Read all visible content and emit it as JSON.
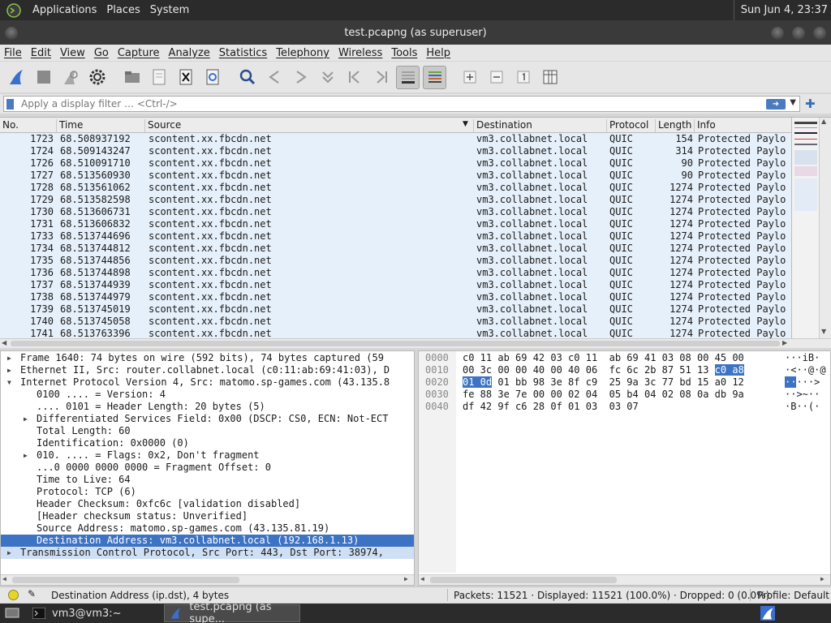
{
  "top_panel": {
    "menus": [
      "Applications",
      "Places",
      "System"
    ],
    "clock": "Sun Jun  4, 23:37"
  },
  "window": {
    "title": "test.pcapng (as superuser)"
  },
  "menubar": [
    "File",
    "Edit",
    "View",
    "Go",
    "Capture",
    "Analyze",
    "Statistics",
    "Telephony",
    "Wireless",
    "Tools",
    "Help"
  ],
  "filter": {
    "placeholder": "Apply a display filter … <Ctrl-/>"
  },
  "packet_list": {
    "columns": [
      "No.",
      "Time",
      "Source",
      "Destination",
      "Protocol",
      "Length",
      "Info"
    ],
    "rows": [
      [
        "1723",
        "68.508937192",
        "scontent.xx.fbcdn.net",
        "vm3.collabnet.local",
        "QUIC",
        "154",
        "Protected Paylo"
      ],
      [
        "1724",
        "68.509143247",
        "scontent.xx.fbcdn.net",
        "vm3.collabnet.local",
        "QUIC",
        "314",
        "Protected Paylo"
      ],
      [
        "1726",
        "68.510091710",
        "scontent.xx.fbcdn.net",
        "vm3.collabnet.local",
        "QUIC",
        "90",
        "Protected Paylo"
      ],
      [
        "1727",
        "68.513560930",
        "scontent.xx.fbcdn.net",
        "vm3.collabnet.local",
        "QUIC",
        "90",
        "Protected Paylo"
      ],
      [
        "1728",
        "68.513561062",
        "scontent.xx.fbcdn.net",
        "vm3.collabnet.local",
        "QUIC",
        "1274",
        "Protected Paylo"
      ],
      [
        "1729",
        "68.513582598",
        "scontent.xx.fbcdn.net",
        "vm3.collabnet.local",
        "QUIC",
        "1274",
        "Protected Paylo"
      ],
      [
        "1730",
        "68.513606731",
        "scontent.xx.fbcdn.net",
        "vm3.collabnet.local",
        "QUIC",
        "1274",
        "Protected Paylo"
      ],
      [
        "1731",
        "68.513606832",
        "scontent.xx.fbcdn.net",
        "vm3.collabnet.local",
        "QUIC",
        "1274",
        "Protected Paylo"
      ],
      [
        "1733",
        "68.513744696",
        "scontent.xx.fbcdn.net",
        "vm3.collabnet.local",
        "QUIC",
        "1274",
        "Protected Paylo"
      ],
      [
        "1734",
        "68.513744812",
        "scontent.xx.fbcdn.net",
        "vm3.collabnet.local",
        "QUIC",
        "1274",
        "Protected Paylo"
      ],
      [
        "1735",
        "68.513744856",
        "scontent.xx.fbcdn.net",
        "vm3.collabnet.local",
        "QUIC",
        "1274",
        "Protected Paylo"
      ],
      [
        "1736",
        "68.513744898",
        "scontent.xx.fbcdn.net",
        "vm3.collabnet.local",
        "QUIC",
        "1274",
        "Protected Paylo"
      ],
      [
        "1737",
        "68.513744939",
        "scontent.xx.fbcdn.net",
        "vm3.collabnet.local",
        "QUIC",
        "1274",
        "Protected Paylo"
      ],
      [
        "1738",
        "68.513744979",
        "scontent.xx.fbcdn.net",
        "vm3.collabnet.local",
        "QUIC",
        "1274",
        "Protected Paylo"
      ],
      [
        "1739",
        "68.513745019",
        "scontent.xx.fbcdn.net",
        "vm3.collabnet.local",
        "QUIC",
        "1274",
        "Protected Paylo"
      ],
      [
        "1740",
        "68.513745058",
        "scontent.xx.fbcdn.net",
        "vm3.collabnet.local",
        "QUIC",
        "1274",
        "Protected Paylo"
      ],
      [
        "1741",
        "68.513763396",
        "scontent.xx.fbcdn.net",
        "vm3.collabnet.local",
        "QUIC",
        "1274",
        "Protected Paylo"
      ]
    ]
  },
  "details": {
    "rows": [
      {
        "arrow": "▶",
        "text": "Frame 1640: 74 bytes on wire (592 bits), 74 bytes captured (59"
      },
      {
        "arrow": "▶",
        "text": "Ethernet II, Src: router.collabnet.local (c0:11:ab:69:41:03), D"
      },
      {
        "arrow": "▼",
        "text": "Internet Protocol Version 4, Src: matomo.sp-games.com (43.135.8"
      },
      {
        "arrow": "",
        "text": "0100 .... = Version: 4"
      },
      {
        "arrow": "",
        "text": ".... 0101 = Header Length: 20 bytes (5)"
      },
      {
        "arrow": "▶",
        "text": "Differentiated Services Field: 0x00 (DSCP: CS0, ECN: Not-ECT"
      },
      {
        "arrow": "",
        "text": "Total Length: 60"
      },
      {
        "arrow": "",
        "text": "Identification: 0x0000 (0)"
      },
      {
        "arrow": "▶",
        "text": "010. .... = Flags: 0x2, Don't fragment"
      },
      {
        "arrow": "",
        "text": "...0 0000 0000 0000 = Fragment Offset: 0"
      },
      {
        "arrow": "",
        "text": "Time to Live: 64"
      },
      {
        "arrow": "",
        "text": "Protocol: TCP (6)"
      },
      {
        "arrow": "",
        "text": "Header Checksum: 0xfc6c [validation disabled]"
      },
      {
        "arrow": "",
        "text": "[Header checksum status: Unverified]"
      },
      {
        "arrow": "",
        "text": "Source Address: matomo.sp-games.com (43.135.81.19)"
      },
      {
        "arrow": "",
        "text": "Destination Address: vm3.collabnet.local (192.168.1.13)"
      },
      {
        "arrow": "▶",
        "text": "Transmission Control Protocol, Src Port: 443, Dst Port: 38974,"
      }
    ]
  },
  "bytes": {
    "rows": [
      {
        "offset": "0000",
        "hex_a": "c0 11 ab 69 42 03 c0 11  ab 69 41 03 08 00 45 00",
        "hex_sel": "",
        "hex_b": "",
        "ascii_a": "···iB·",
        "ascii_sel": "",
        "ascii_b": ""
      },
      {
        "offset": "0010",
        "hex_a": "00 3c 00 00 40 00 40 06  fc 6c 2b 87 51 13 ",
        "hex_sel": "c0 a8",
        "hex_b": "",
        "ascii_a": "·<··@·@",
        "ascii_sel": "",
        "ascii_b": ""
      },
      {
        "offset": "0020",
        "hex_a": "",
        "hex_sel": "01 0d",
        "hex_b": " 01 bb 98 3e 8f c9  25 9a 3c 77 bd 15 a0 12",
        "ascii_a": "",
        "ascii_sel": "··",
        "ascii_b": "···>"
      },
      {
        "offset": "0030",
        "hex_a": "fe 88 3e 7e 00 00 02 04  05 b4 04 02 08 0a db 9a",
        "hex_sel": "",
        "hex_b": "",
        "ascii_a": "··>~··",
        "ascii_sel": "",
        "ascii_b": ""
      },
      {
        "offset": "0040",
        "hex_a": "df 42 9f c6 28 0f 01 03  03 07",
        "hex_sel": "",
        "hex_b": "",
        "ascii_a": "·B··(·",
        "ascii_sel": "",
        "ascii_b": ""
      }
    ]
  },
  "statusbar": {
    "field": "Destination Address (ip.dst), 4 bytes",
    "packets": "Packets: 11521 · Displayed: 11521 (100.0%) · Dropped: 0 (0.0%)",
    "profile": "Profile: Default"
  },
  "taskbar": {
    "tasks": [
      "vm3@vm3:~",
      "test.pcapng (as supe..."
    ]
  },
  "colors": {
    "row_bg": "#e6f0fa",
    "selection": "#3d73c4",
    "accent": "#4b7bbf"
  }
}
